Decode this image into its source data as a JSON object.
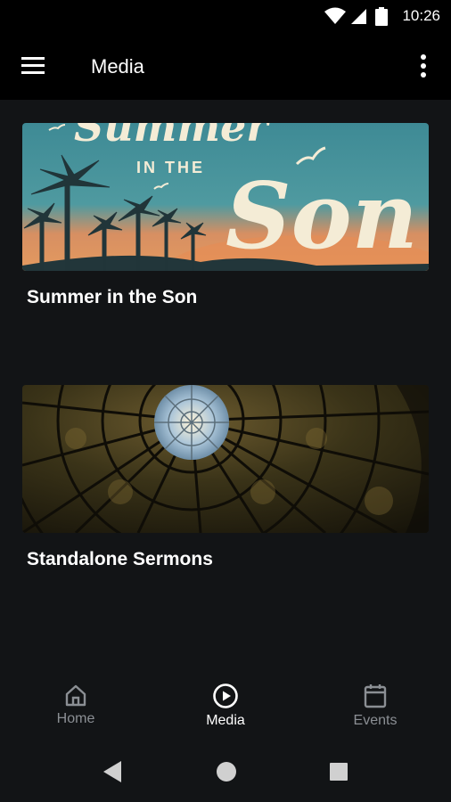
{
  "status_bar": {
    "time": "10:26"
  },
  "app_bar": {
    "title": "Media"
  },
  "cards": [
    {
      "title": "Summer in the Son",
      "art_text_top": "Summer",
      "art_text_mid": "IN THE",
      "art_text_big": "Son"
    },
    {
      "title": "Standalone Sermons"
    }
  ],
  "bottom_nav": {
    "items": [
      {
        "label": "Home",
        "icon": "home-icon"
      },
      {
        "label": "Media",
        "icon": "play-circle-icon",
        "active": true
      },
      {
        "label": "Events",
        "icon": "calendar-icon"
      }
    ]
  },
  "colors": {
    "background": "#121416",
    "bar": "#000000",
    "inactive": "#8b8f94",
    "active": "#ffffff"
  }
}
